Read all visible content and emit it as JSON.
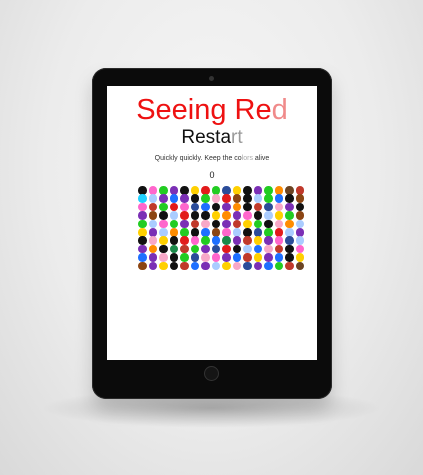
{
  "app": {
    "title_main": "Seeing Re",
    "title_faded": "d",
    "restart_main": "Resta",
    "restart_faded": "rt",
    "subtitle_main": "Quickly quickly. Keep the co",
    "subtitle_faded": "lors",
    "subtitle_end": " alive",
    "score": "0"
  },
  "colors": {
    "title_red": "#ee1111",
    "title_faded_red": "#f08a8a",
    "palette": [
      "#111111",
      "#ff66cc",
      "#22cc22",
      "#7b2fb5",
      "#e21b1b",
      "#ffd000",
      "#1e6fff",
      "#8b4513",
      "#2b4c99",
      "#c0392b",
      "#aaccff",
      "#1b8a4a",
      "#f7a8c8",
      "#ff8c00",
      "#6b4423",
      "#1fd0ff"
    ]
  },
  "grid": {
    "columns": 16,
    "rows": 10,
    "cells": [
      [
        0,
        1,
        2,
        3,
        0,
        5,
        4,
        2,
        8,
        5,
        0,
        3,
        2,
        13,
        14,
        9
      ],
      [
        15,
        10,
        3,
        6,
        3,
        0,
        2,
        12,
        4,
        7,
        0,
        10,
        2,
        6,
        0,
        7
      ],
      [
        1,
        9,
        2,
        4,
        1,
        8,
        6,
        0,
        3,
        13,
        0,
        9,
        8,
        12,
        3,
        0
      ],
      [
        3,
        7,
        0,
        10,
        4,
        0,
        0,
        5,
        13,
        3,
        1,
        0,
        10,
        5,
        2,
        7
      ],
      [
        2,
        10,
        1,
        2,
        3,
        9,
        12,
        0,
        3,
        9,
        5,
        2,
        0,
        12,
        13,
        10
      ],
      [
        5,
        3,
        10,
        13,
        2,
        0,
        6,
        7,
        1,
        10,
        0,
        8,
        2,
        4,
        10,
        3
      ],
      [
        0,
        12,
        5,
        0,
        4,
        1,
        2,
        6,
        11,
        3,
        9,
        5,
        3,
        1,
        8,
        10
      ],
      [
        3,
        13,
        0,
        11,
        9,
        2,
        3,
        8,
        4,
        0,
        10,
        6,
        12,
        9,
        0,
        1
      ],
      [
        6,
        3,
        12,
        0,
        2,
        8,
        12,
        1,
        3,
        6,
        9,
        5,
        3,
        6,
        0,
        5
      ],
      [
        7,
        3,
        5,
        0,
        9,
        6,
        3,
        10,
        5,
        12,
        8,
        3,
        6,
        2,
        9,
        14
      ]
    ]
  }
}
